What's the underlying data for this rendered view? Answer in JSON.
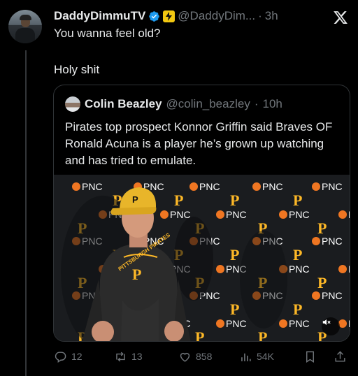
{
  "post": {
    "author_name": "DaddyDimmuTV",
    "author_handle": "@DaddyDim...",
    "separator": "·",
    "time": "3h",
    "line1": "You wanna feel old?",
    "line2": "Holy shit"
  },
  "quote": {
    "author_name": "Colin Beazley",
    "author_handle": "@colin_beazley",
    "separator": "·",
    "time": "10h",
    "text": "Pirates top prospect Konnor Griffin said Braves OF Ronald Acuna is a player he’s grown up watching and has tried to emulate."
  },
  "media": {
    "backdrop_brand": "PNC",
    "backdrop_letter": "P",
    "shirt_text": "PITTSBURGH PIRATES",
    "shirt_letter": "P",
    "cap_letter": "P",
    "colors": {
      "backdrop": "#1a1c1f",
      "gold": "#fdb827",
      "orange": "#ef7622"
    }
  },
  "actions": {
    "replies": "12",
    "reposts": "13",
    "likes": "858",
    "views": "54K"
  },
  "colors": {
    "background": "#000000",
    "text": "#e7e9ea",
    "muted": "#71767b",
    "border": "#2f3336",
    "verified": "#1d9bf0"
  }
}
